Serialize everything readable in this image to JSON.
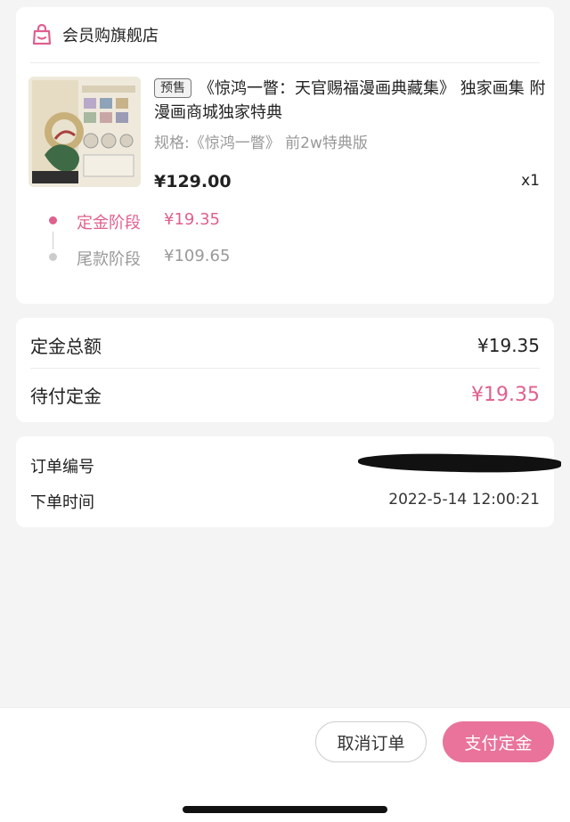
{
  "shop": {
    "name": "会员购旗舰店",
    "icon": "shopping-bag-icon"
  },
  "product": {
    "tag": "预售",
    "title": "《惊鸿一瞥：天官赐福漫画典藏集》 独家画集 附漫画商城独家特典",
    "spec": "规格:《惊鸿一瞥》 前2w特典版",
    "price": "¥129.00",
    "quantity": "x1",
    "cover_title": "惊鸿一瞥"
  },
  "stages": [
    {
      "label": "定金阶段",
      "amount": "¥19.35",
      "active": true
    },
    {
      "label": "尾款阶段",
      "amount": "¥109.65",
      "active": false
    }
  ],
  "totals": {
    "deposit_total_label": "定金总额",
    "deposit_total_value": "¥19.35",
    "deposit_due_label": "待付定金",
    "deposit_due_value": "¥19.35"
  },
  "order": {
    "number_label": "订单编号",
    "time_label": "下单时间",
    "time_value": "2022-5-14 12:00:21"
  },
  "actions": {
    "cancel_label": "取消订单",
    "pay_label": "支付定金"
  },
  "colors": {
    "accent": "#e0608d",
    "pay_button": "#e9739b",
    "muted": "#999999"
  }
}
